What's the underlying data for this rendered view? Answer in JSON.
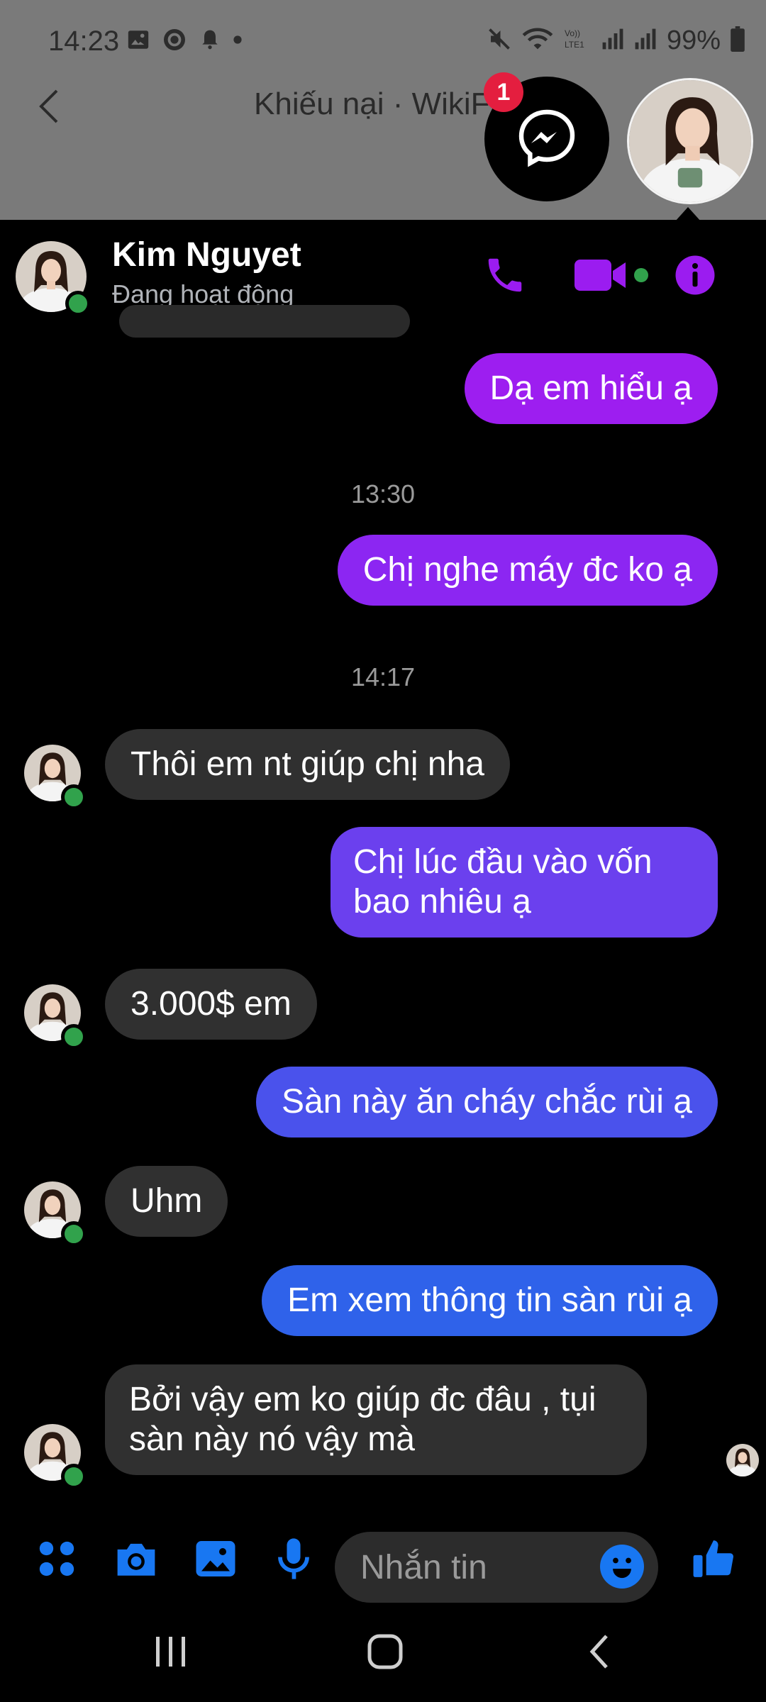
{
  "status_bar": {
    "time": "14:23",
    "battery": "99%",
    "icons_left": [
      "image-icon",
      "sync-icon",
      "bell-icon",
      "dot-icon"
    ],
    "icons_right": [
      "mute-icon",
      "wifi-icon",
      "volte-icon",
      "signal-icon",
      "signal-icon",
      "battery-icon"
    ]
  },
  "background_app": {
    "title": "Khiếu nại · WikiF"
  },
  "chat_heads": {
    "badge_count": "1"
  },
  "chat_header": {
    "name": "Kim Nguyet",
    "status": "Đang hoạt động",
    "icons": [
      "phone-icon",
      "video-icon",
      "info-icon"
    ],
    "accent_color": "#9b1cf0"
  },
  "messages": [
    {
      "type": "outgoing",
      "text": "Dạ em hiểu ạ",
      "color": "#9d1ef0"
    },
    {
      "type": "timestamp",
      "text": "13:30"
    },
    {
      "type": "outgoing",
      "text": "Chị nghe máy đc ko ạ",
      "color": "#8c26f2"
    },
    {
      "type": "timestamp",
      "text": "14:17"
    },
    {
      "type": "incoming",
      "text": "Thôi em nt giúp chị nha"
    },
    {
      "type": "outgoing",
      "text": "Chị lúc đầu vào vốn bao nhiêu ạ",
      "color": "#6b40ee"
    },
    {
      "type": "incoming",
      "text": "3.000$ em"
    },
    {
      "type": "outgoing",
      "text": "Sàn này ăn cháy chắc rùi ạ",
      "color": "#4a52ec"
    },
    {
      "type": "incoming",
      "text": "Uhm"
    },
    {
      "type": "outgoing",
      "text": "Em xem thông tin sàn rùi ạ",
      "color": "#2f62ea"
    },
    {
      "type": "incoming",
      "text": "Bởi vậy em ko giúp đc đâu , tụi sàn này nó vậy mà"
    }
  ],
  "composer": {
    "placeholder": "Nhắn tin",
    "icons": [
      "apps-icon",
      "camera-icon",
      "gallery-icon",
      "mic-icon",
      "emoji-icon",
      "like-icon"
    ],
    "accent_color": "#1877f2"
  },
  "nav_bar": {
    "icons": [
      "recents-icon",
      "home-icon",
      "back-icon"
    ]
  }
}
